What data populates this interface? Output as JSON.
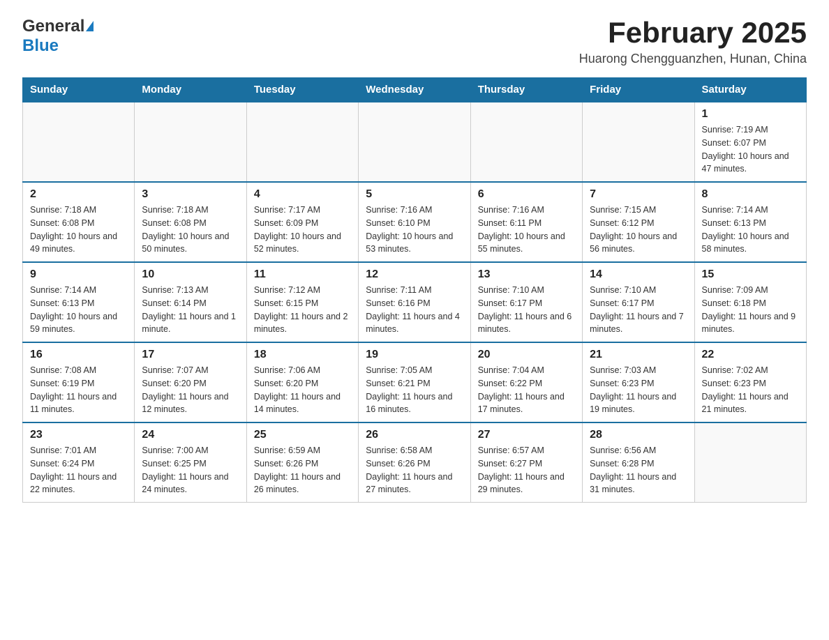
{
  "logo": {
    "general": "General",
    "blue": "Blue",
    "arrow": "▶"
  },
  "header": {
    "title": "February 2025",
    "subtitle": "Huarong Chengguanzhen, Hunan, China"
  },
  "weekdays": [
    "Sunday",
    "Monday",
    "Tuesday",
    "Wednesday",
    "Thursday",
    "Friday",
    "Saturday"
  ],
  "weeks": [
    [
      {
        "day": "",
        "info": ""
      },
      {
        "day": "",
        "info": ""
      },
      {
        "day": "",
        "info": ""
      },
      {
        "day": "",
        "info": ""
      },
      {
        "day": "",
        "info": ""
      },
      {
        "day": "",
        "info": ""
      },
      {
        "day": "1",
        "info": "Sunrise: 7:19 AM\nSunset: 6:07 PM\nDaylight: 10 hours and 47 minutes."
      }
    ],
    [
      {
        "day": "2",
        "info": "Sunrise: 7:18 AM\nSunset: 6:08 PM\nDaylight: 10 hours and 49 minutes."
      },
      {
        "day": "3",
        "info": "Sunrise: 7:18 AM\nSunset: 6:08 PM\nDaylight: 10 hours and 50 minutes."
      },
      {
        "day": "4",
        "info": "Sunrise: 7:17 AM\nSunset: 6:09 PM\nDaylight: 10 hours and 52 minutes."
      },
      {
        "day": "5",
        "info": "Sunrise: 7:16 AM\nSunset: 6:10 PM\nDaylight: 10 hours and 53 minutes."
      },
      {
        "day": "6",
        "info": "Sunrise: 7:16 AM\nSunset: 6:11 PM\nDaylight: 10 hours and 55 minutes."
      },
      {
        "day": "7",
        "info": "Sunrise: 7:15 AM\nSunset: 6:12 PM\nDaylight: 10 hours and 56 minutes."
      },
      {
        "day": "8",
        "info": "Sunrise: 7:14 AM\nSunset: 6:13 PM\nDaylight: 10 hours and 58 minutes."
      }
    ],
    [
      {
        "day": "9",
        "info": "Sunrise: 7:14 AM\nSunset: 6:13 PM\nDaylight: 10 hours and 59 minutes."
      },
      {
        "day": "10",
        "info": "Sunrise: 7:13 AM\nSunset: 6:14 PM\nDaylight: 11 hours and 1 minute."
      },
      {
        "day": "11",
        "info": "Sunrise: 7:12 AM\nSunset: 6:15 PM\nDaylight: 11 hours and 2 minutes."
      },
      {
        "day": "12",
        "info": "Sunrise: 7:11 AM\nSunset: 6:16 PM\nDaylight: 11 hours and 4 minutes."
      },
      {
        "day": "13",
        "info": "Sunrise: 7:10 AM\nSunset: 6:17 PM\nDaylight: 11 hours and 6 minutes."
      },
      {
        "day": "14",
        "info": "Sunrise: 7:10 AM\nSunset: 6:17 PM\nDaylight: 11 hours and 7 minutes."
      },
      {
        "day": "15",
        "info": "Sunrise: 7:09 AM\nSunset: 6:18 PM\nDaylight: 11 hours and 9 minutes."
      }
    ],
    [
      {
        "day": "16",
        "info": "Sunrise: 7:08 AM\nSunset: 6:19 PM\nDaylight: 11 hours and 11 minutes."
      },
      {
        "day": "17",
        "info": "Sunrise: 7:07 AM\nSunset: 6:20 PM\nDaylight: 11 hours and 12 minutes."
      },
      {
        "day": "18",
        "info": "Sunrise: 7:06 AM\nSunset: 6:20 PM\nDaylight: 11 hours and 14 minutes."
      },
      {
        "day": "19",
        "info": "Sunrise: 7:05 AM\nSunset: 6:21 PM\nDaylight: 11 hours and 16 minutes."
      },
      {
        "day": "20",
        "info": "Sunrise: 7:04 AM\nSunset: 6:22 PM\nDaylight: 11 hours and 17 minutes."
      },
      {
        "day": "21",
        "info": "Sunrise: 7:03 AM\nSunset: 6:23 PM\nDaylight: 11 hours and 19 minutes."
      },
      {
        "day": "22",
        "info": "Sunrise: 7:02 AM\nSunset: 6:23 PM\nDaylight: 11 hours and 21 minutes."
      }
    ],
    [
      {
        "day": "23",
        "info": "Sunrise: 7:01 AM\nSunset: 6:24 PM\nDaylight: 11 hours and 22 minutes."
      },
      {
        "day": "24",
        "info": "Sunrise: 7:00 AM\nSunset: 6:25 PM\nDaylight: 11 hours and 24 minutes."
      },
      {
        "day": "25",
        "info": "Sunrise: 6:59 AM\nSunset: 6:26 PM\nDaylight: 11 hours and 26 minutes."
      },
      {
        "day": "26",
        "info": "Sunrise: 6:58 AM\nSunset: 6:26 PM\nDaylight: 11 hours and 27 minutes."
      },
      {
        "day": "27",
        "info": "Sunrise: 6:57 AM\nSunset: 6:27 PM\nDaylight: 11 hours and 29 minutes."
      },
      {
        "day": "28",
        "info": "Sunrise: 6:56 AM\nSunset: 6:28 PM\nDaylight: 11 hours and 31 minutes."
      },
      {
        "day": "",
        "info": ""
      }
    ]
  ]
}
